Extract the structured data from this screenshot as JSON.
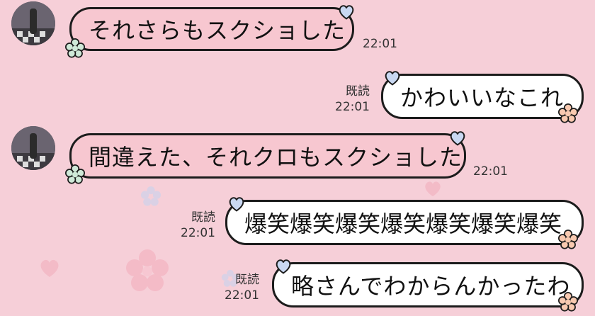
{
  "theme": {
    "background": "#f6cfd8",
    "incoming_bubble": "#f7c7d0",
    "outgoing_bubble": "#ffffff",
    "bubble_border": "#1c1c1c"
  },
  "messages": [
    {
      "direction": "incoming",
      "text": "それさらもスクショした",
      "time": "22:01"
    },
    {
      "direction": "outgoing",
      "text": "かわいいなこれ",
      "read": "既読",
      "time": "22:01"
    },
    {
      "direction": "incoming",
      "text": "間違えた、それクロもスクショした",
      "time": "22:01"
    },
    {
      "direction": "outgoing",
      "text": "爆笑爆笑爆笑爆笑爆笑爆笑爆笑",
      "read": "既読",
      "time": "22:01"
    },
    {
      "direction": "outgoing",
      "text": "略さんでわからんかったわ",
      "read": "既読",
      "time": "22:01"
    }
  ]
}
